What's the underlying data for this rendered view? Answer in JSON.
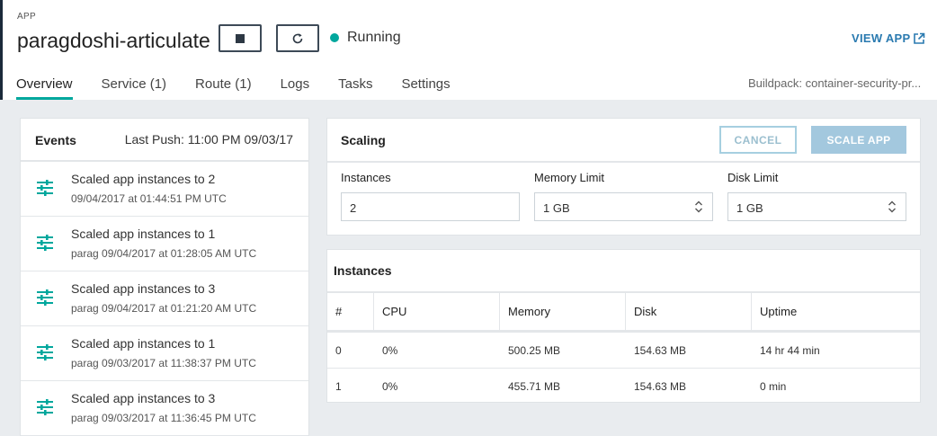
{
  "header": {
    "app_label": "APP",
    "app_name": "paragdoshi-articulate",
    "status_text": "Running",
    "status_color": "#00a79d",
    "view_app_label": "VIEW APP",
    "buildpack": "Buildpack: container-security-pr..."
  },
  "tabs": [
    {
      "label": "Overview",
      "active": true
    },
    {
      "label": "Service (1)"
    },
    {
      "label": "Route (1)"
    },
    {
      "label": "Logs"
    },
    {
      "label": "Tasks"
    },
    {
      "label": "Settings"
    }
  ],
  "events": {
    "title": "Events",
    "last_push": "Last Push: 11:00 PM 09/03/17",
    "items": [
      {
        "text": "Scaled app instances to 2",
        "meta": "09/04/2017 at 01:44:51 PM UTC"
      },
      {
        "text": "Scaled app instances to 1",
        "meta": "parag 09/04/2017 at 01:28:05 AM UTC"
      },
      {
        "text": "Scaled app instances to 3",
        "meta": "parag 09/04/2017 at 01:21:20 AM UTC"
      },
      {
        "text": "Scaled app instances to 1",
        "meta": "parag 09/03/2017 at 11:38:37 PM UTC"
      },
      {
        "text": "Scaled app instances to 3",
        "meta": "parag 09/03/2017 at 11:36:45 PM UTC"
      }
    ]
  },
  "scaling": {
    "title": "Scaling",
    "cancel_label": "CANCEL",
    "scale_label": "SCALE APP",
    "instances_label": "Instances",
    "instances_value": "2",
    "memory_label": "Memory Limit",
    "memory_value": "1 GB",
    "disk_label": "Disk Limit",
    "disk_value": "1 GB"
  },
  "instances": {
    "title": "Instances",
    "columns": [
      "#",
      "CPU",
      "Memory",
      "Disk",
      "Uptime"
    ],
    "rows": [
      [
        "0",
        "0%",
        "500.25 MB",
        "154.63 MB",
        "14 hr 44 min"
      ],
      [
        "1",
        "0%",
        "455.71 MB",
        "154.63 MB",
        "0 min"
      ]
    ]
  }
}
